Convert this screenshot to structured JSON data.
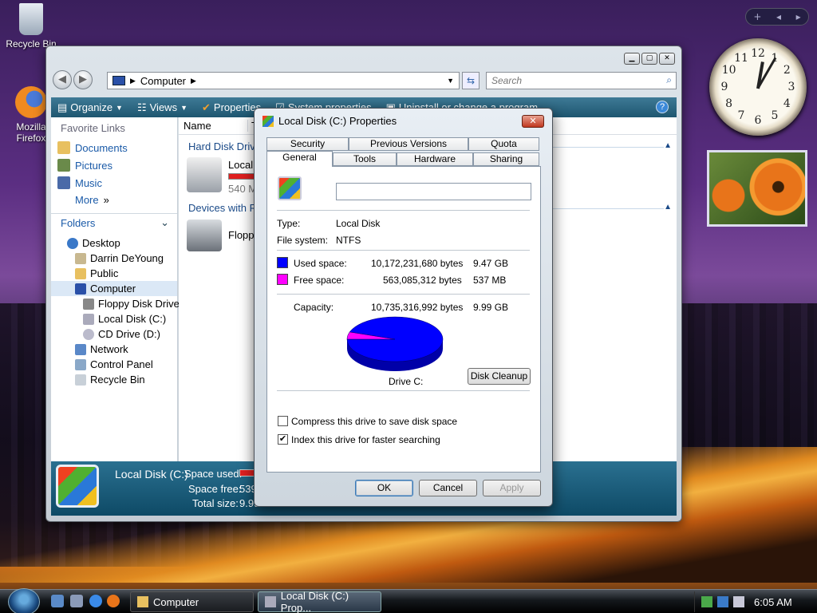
{
  "desktop": {
    "icons": [
      {
        "label": "Recycle Bin"
      },
      {
        "label": "Mozilla Firefox"
      }
    ]
  },
  "gadgets": {
    "sidebar_add": "+",
    "clock_numbers": [
      "12",
      "1",
      "2",
      "3",
      "4",
      "5",
      "6",
      "7",
      "8",
      "9",
      "10",
      "11"
    ]
  },
  "explorer": {
    "address": "Computer",
    "search_placeholder": "Search",
    "toolbar": {
      "organize": "Organize",
      "views": "Views",
      "properties": "Properties",
      "system_properties": "System properties",
      "uninstall": "Uninstall or change a program",
      "help": "?"
    },
    "favorite_links_heading": "Favorite Links",
    "favorites": [
      "Documents",
      "Pictures",
      "Music",
      "More"
    ],
    "folders_heading": "Folders",
    "tree": [
      "Desktop",
      "Darrin DeYoung",
      "Public",
      "Computer",
      "Floppy Disk Drive",
      "Local Disk (C:)",
      "CD Drive (D:)",
      "Network",
      "Control Panel",
      "Recycle Bin"
    ],
    "columns": [
      "Name",
      "T"
    ],
    "groups": {
      "hard_disk": "Hard Disk Drive",
      "removable": "Devices with Re"
    },
    "local_disk_label": "Local",
    "local_disk_size": "540 M",
    "floppy_label": "Floppy",
    "details": {
      "name": "Local Disk (C:)",
      "space_used_label": "Space used:",
      "space_free_label": "Space free:",
      "space_free_value": "539",
      "total_size_label": "Total size:",
      "total_size_value": "9.99"
    }
  },
  "dialog": {
    "title": "Local Disk (C:) Properties",
    "close": "✕",
    "tabs_top": [
      "Security",
      "Previous Versions",
      "Quota"
    ],
    "tabs_bottom": [
      "General",
      "Tools",
      "Hardware",
      "Sharing"
    ],
    "volume_name": "",
    "type_label": "Type:",
    "type_value": "Local Disk",
    "fs_label": "File system:",
    "fs_value": "NTFS",
    "used_label": "Used space:",
    "used_bytes": "10,172,231,680 bytes",
    "used_human": "9.47 GB",
    "free_label": "Free space:",
    "free_bytes": "563,085,312 bytes",
    "free_human": "537 MB",
    "capacity_label": "Capacity:",
    "capacity_bytes": "10,735,316,992 bytes",
    "capacity_human": "9.99 GB",
    "drive_label": "Drive C:",
    "cleanup_button": "Disk Cleanup",
    "compress_label": "Compress this drive to save disk space",
    "compress_checked": false,
    "index_label": "Index this drive for faster searching",
    "index_checked": true,
    "ok": "OK",
    "cancel": "Cancel",
    "apply": "Apply",
    "used_color": "#0000ff",
    "free_color": "#ff00ff"
  },
  "chart_data": {
    "type": "pie",
    "categories": [
      "Used space",
      "Free space"
    ],
    "values": [
      10172231680,
      563085312
    ],
    "title": "Drive C:"
  },
  "taskbar": {
    "tasks": [
      "Computer",
      "Local Disk (C:) Prop..."
    ],
    "time": "6:05 AM"
  }
}
